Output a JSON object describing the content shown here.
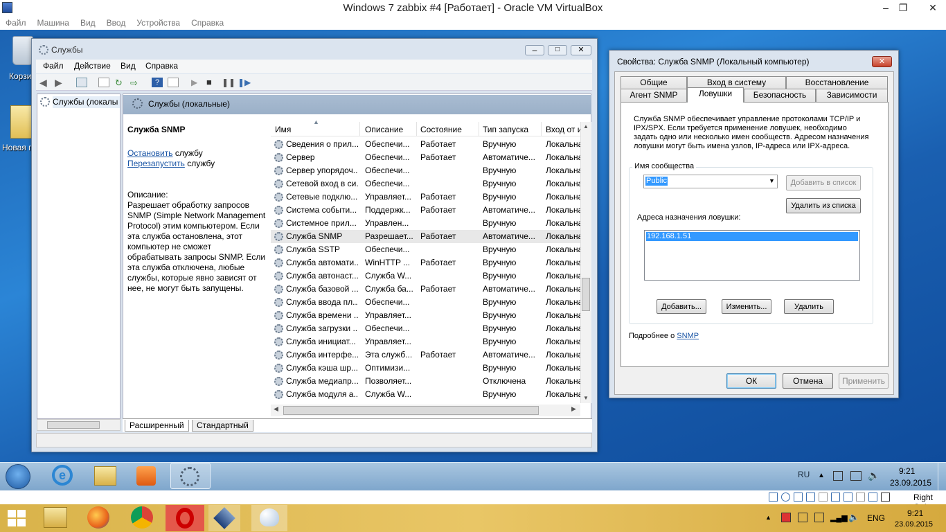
{
  "vbox": {
    "title": "Windows 7 zabbix #4 [Работает] - Oracle VM VirtualBox",
    "menu": [
      "Файл",
      "Машина",
      "Вид",
      "Ввод",
      "Устройства",
      "Справка"
    ]
  },
  "desktop": {
    "icons": [
      {
        "label": "Корзи"
      },
      {
        "label": "Новая п"
      }
    ]
  },
  "services": {
    "title": "Службы",
    "menu": [
      "Файл",
      "Действие",
      "Вид",
      "Справка"
    ],
    "tree_item": "Службы (локалы",
    "header": "Службы (локальные)",
    "selected_name": "Служба SNMP",
    "stop_link": "Остановить",
    "stop_rest": " службу",
    "restart_link": "Перезапустить",
    "restart_rest": " службу",
    "desc_label": "Описание:",
    "desc_text": "Разрешает обработку запросов SNMP (Simple Network Management Protocol) этим компьютером. Если эта служба остановлена, этот компьютер не сможет обрабатывать запросы SNMP. Если эта служба отключена, любые службы, которые явно зависят от нее, не могут быть запущены.",
    "columns": [
      "Имя",
      "Описание",
      "Состояние",
      "Тип запуска",
      "Вход от и"
    ],
    "rows": [
      [
        "Сведения о прил...",
        "Обеспечи...",
        "Работает",
        "Вручную",
        "Локальна"
      ],
      [
        "Сервер",
        "Обеспечи...",
        "Работает",
        "Автоматиче...",
        "Локальна"
      ],
      [
        "Сервер упорядоч...",
        "Обеспечи...",
        "",
        "Вручную",
        "Локальна"
      ],
      [
        "Сетевой вход в си...",
        "Обеспечи...",
        "",
        "Вручную",
        "Локальна"
      ],
      [
        "Сетевые подклю...",
        "Управляет...",
        "Работает",
        "Вручную",
        "Локальна"
      ],
      [
        "Система событи...",
        "Поддержк...",
        "Работает",
        "Автоматиче...",
        "Локальна"
      ],
      [
        "Системное прил...",
        "Управлен...",
        "",
        "Вручную",
        "Локальна"
      ],
      [
        "Служба SNMP",
        "Разрешает...",
        "Работает",
        "Автоматиче...",
        "Локальна"
      ],
      [
        "Служба SSTP",
        "Обеспечи...",
        "",
        "Вручную",
        "Локальна"
      ],
      [
        "Служба автомати...",
        "WinHTTP ...",
        "Работает",
        "Вручную",
        "Локальна"
      ],
      [
        "Служба автонаст...",
        "Служба W...",
        "",
        "Вручную",
        "Локальна"
      ],
      [
        "Служба базовой ...",
        "Служба ба...",
        "Работает",
        "Автоматиче...",
        "Локальна"
      ],
      [
        "Служба ввода пл...",
        "Обеспечи...",
        "",
        "Вручную",
        "Локальна"
      ],
      [
        "Служба времени ...",
        "Управляет...",
        "",
        "Вручную",
        "Локальна"
      ],
      [
        "Служба загрузки ...",
        "Обеспечи...",
        "",
        "Вручную",
        "Локальна"
      ],
      [
        "Служба инициат...",
        "Управляет...",
        "",
        "Вручную",
        "Локальна"
      ],
      [
        "Служба интерфе...",
        "Эта служб...",
        "Работает",
        "Автоматиче...",
        "Локальна"
      ],
      [
        "Служба кэша шр...",
        "Оптимизи...",
        "",
        "Вручную",
        "Локальна"
      ],
      [
        "Служба медиапр...",
        "Позволяет...",
        "",
        "Отключена",
        "Локальна"
      ],
      [
        "Служба модуля а...",
        "Служба W...",
        "",
        "Вручную",
        "Локальна"
      ]
    ],
    "tabs": [
      "Расширенный",
      "Стандартный"
    ]
  },
  "props": {
    "title": "Свойства: Служба SNMP (Локальный компьютер)",
    "tabs_top": [
      "Общие",
      "Вход в систему",
      "Восстановление"
    ],
    "tabs_bottom": [
      "Агент SNMP",
      "Ловушки",
      "Безопасность",
      "Зависимости"
    ],
    "info": "Служба SNMP обеспечивает управление протоколами TCP/IP и IPX/SPX. Если требуется применение ловушек, необходимо задать одно или несколько имен сообществ. Адресом назначения ловушки могут быть имена узлов, IP-адреса или IPX-адреса.",
    "community_label": "Имя сообщества",
    "community_value": "Public",
    "add_to_list": "Добавить в список",
    "remove_from_list": "Удалить из списка",
    "dest_label": "Адреса назначения ловушки:",
    "dest_items": [
      "192.168.1.51"
    ],
    "add": "Добавить...",
    "edit": "Изменить...",
    "remove": "Удалить",
    "more_prefix": "Подробнее о ",
    "more_link": "SNMP",
    "ok": "ОК",
    "cancel": "Отмена",
    "apply": "Применить"
  },
  "guest_taskbar": {
    "lang": "RU",
    "time": "9:21",
    "date": "23.09.2015"
  },
  "vbox_status": {
    "host_key": "Right Ctrl"
  },
  "host_taskbar": {
    "lang": "ENG",
    "time": "9:21",
    "date": "23.09.2015"
  }
}
